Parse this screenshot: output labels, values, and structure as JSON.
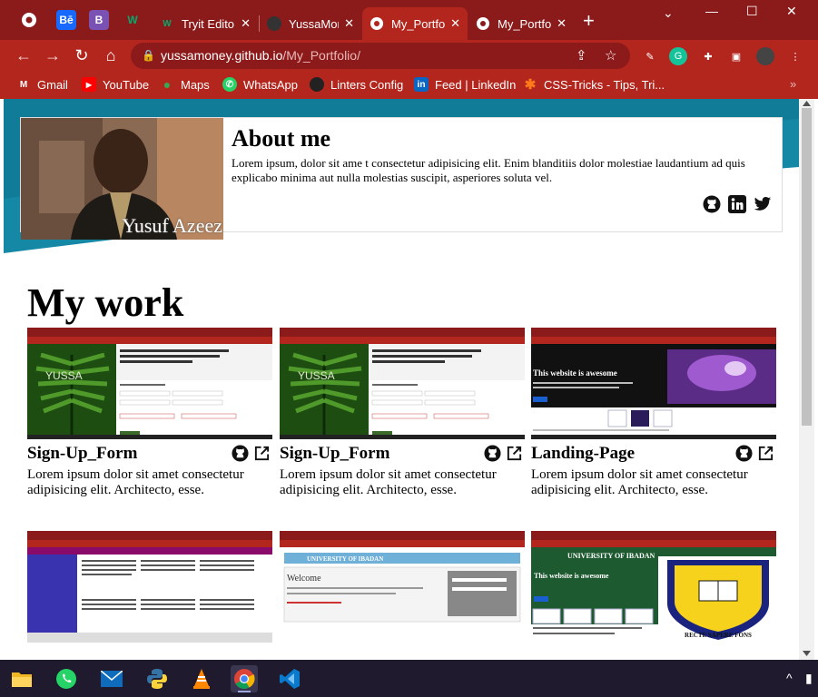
{
  "browser": {
    "tabs": [
      {
        "label": "Tryit Edito",
        "favicon": "w3schools-icon"
      },
      {
        "label": "YussaMon",
        "favicon": "github-icon"
      },
      {
        "label": "My_Portfo",
        "favicon": "chrome-icon",
        "active": true
      },
      {
        "label": "My_Portfo",
        "favicon": "chrome-icon"
      }
    ],
    "url_host": "yussamoney.github.io",
    "url_path": "/My_Portfolio/",
    "bookmarks": [
      {
        "label": "Gmail",
        "icon": "gmail-icon"
      },
      {
        "label": "YouTube",
        "icon": "youtube-icon"
      },
      {
        "label": "Maps",
        "icon": "maps-icon"
      },
      {
        "label": "WhatsApp",
        "icon": "whatsapp-icon"
      },
      {
        "label": "Linters Config",
        "icon": "github-icon"
      },
      {
        "label": "Feed | LinkedIn",
        "icon": "linkedin-icon"
      },
      {
        "label": "CSS-Tricks - Tips, Tri...",
        "icon": "csstricks-icon"
      }
    ]
  },
  "about": {
    "photo_name": "Yusuf Azeez",
    "title": "About me",
    "text": "Lorem ipsum, dolor sit ame t consectetur adipisicing elit. Enim blanditiis dolor molestiae laudantium ad quis explicabo minima aut nulla molestias suscipit, asperiores soluta vel."
  },
  "work": {
    "heading": "My work",
    "projects": [
      {
        "title": "Sign-Up_Form",
        "desc": "Lorem ipsum dolor sit amet consectetur adipisicing elit. Architecto, esse.",
        "thumb_brand": "YUSSA"
      },
      {
        "title": "Sign-Up_Form",
        "desc": "Lorem ipsum dolor sit amet consectetur adipisicing elit. Architecto, esse.",
        "thumb_brand": "YUSSA"
      },
      {
        "title": "Landing-Page",
        "desc": "Lorem ipsum dolor sit amet consectetur adipisicing elit. Architecto, esse.",
        "thumb_heading": "This website is awesome"
      },
      {
        "title": "",
        "desc": ""
      },
      {
        "title": "",
        "desc": "",
        "thumb_heading": "UNIVERSITY OF IBADAN",
        "thumb_welcome": "Welcome"
      },
      {
        "title": "",
        "desc": "",
        "thumb_heading": "UNIVERSITY OF IBADAN",
        "thumb_sub": "This website is awesome",
        "thumb_crest": "RECTE SAPERE FONS"
      }
    ]
  },
  "colors": {
    "chrome_dark": "#8b1b1b",
    "chrome": "#b3261e",
    "hero_teal": "#1588a6"
  }
}
